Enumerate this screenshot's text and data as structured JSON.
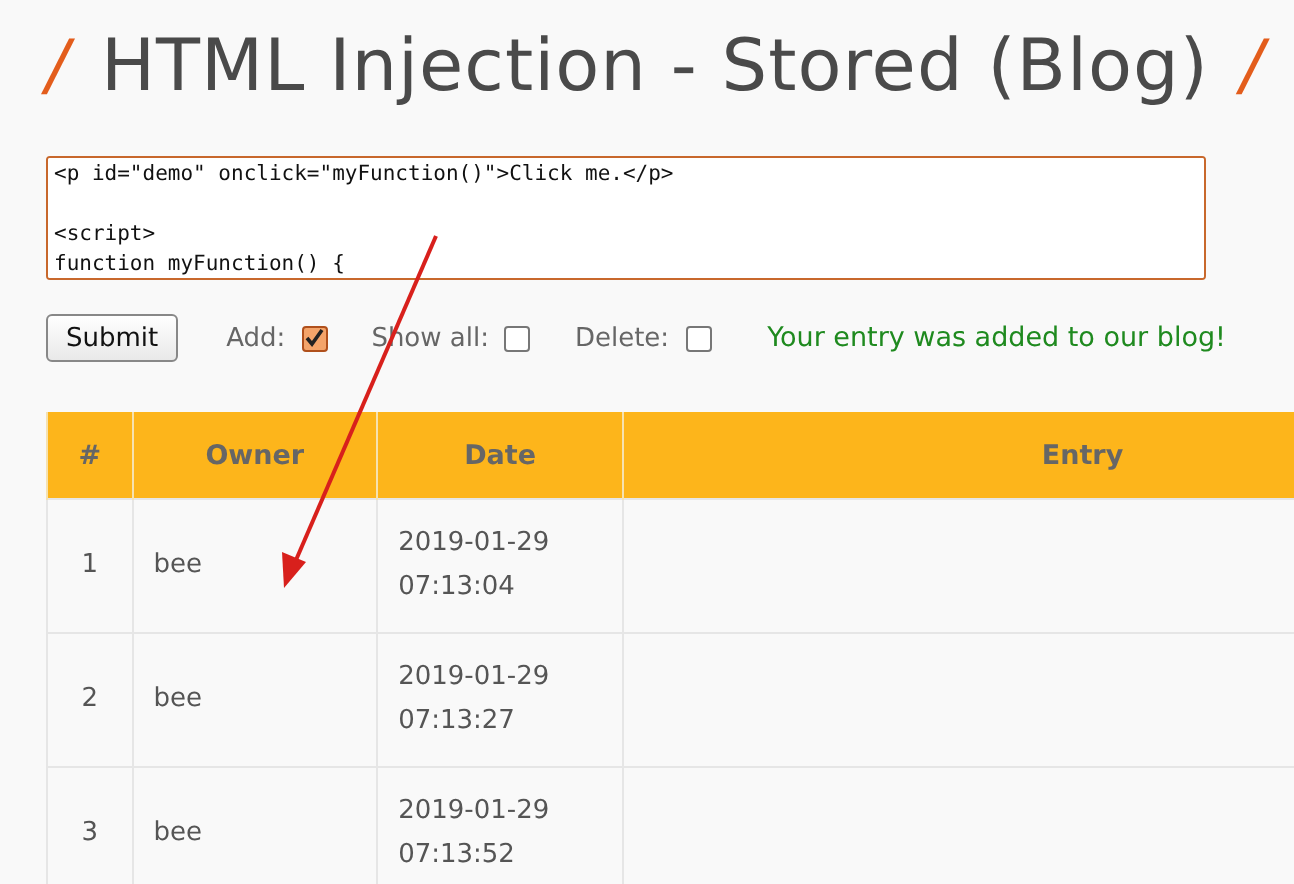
{
  "title": "HTML Injection - Stored (Blog)",
  "title_mark": "/",
  "entry_field": {
    "value": "<p id=\"demo\" onclick=\"myFunction()\">Click me.</p>\n\n<script>\nfunction myFunction() {"
  },
  "submit_button": "Submit",
  "options": [
    {
      "label": "Add:",
      "checked": true
    },
    {
      "label": "Show all:",
      "checked": false
    },
    {
      "label": "Delete:",
      "checked": false
    }
  ],
  "message": "Your entry was added to our blog!",
  "table": {
    "columns": [
      "#",
      "Owner",
      "Date",
      "Entry"
    ],
    "rows": [
      {
        "number": "1",
        "owner": "bee",
        "date": "2019-01-29",
        "time": "07:13:04"
      },
      {
        "number": "2",
        "owner": "bee",
        "date": "2019-01-29",
        "time": "07:13:27"
      },
      {
        "number": "3",
        "owner": "bee",
        "date": "2019-01-29",
        "time": "07:13:52"
      }
    ]
  }
}
